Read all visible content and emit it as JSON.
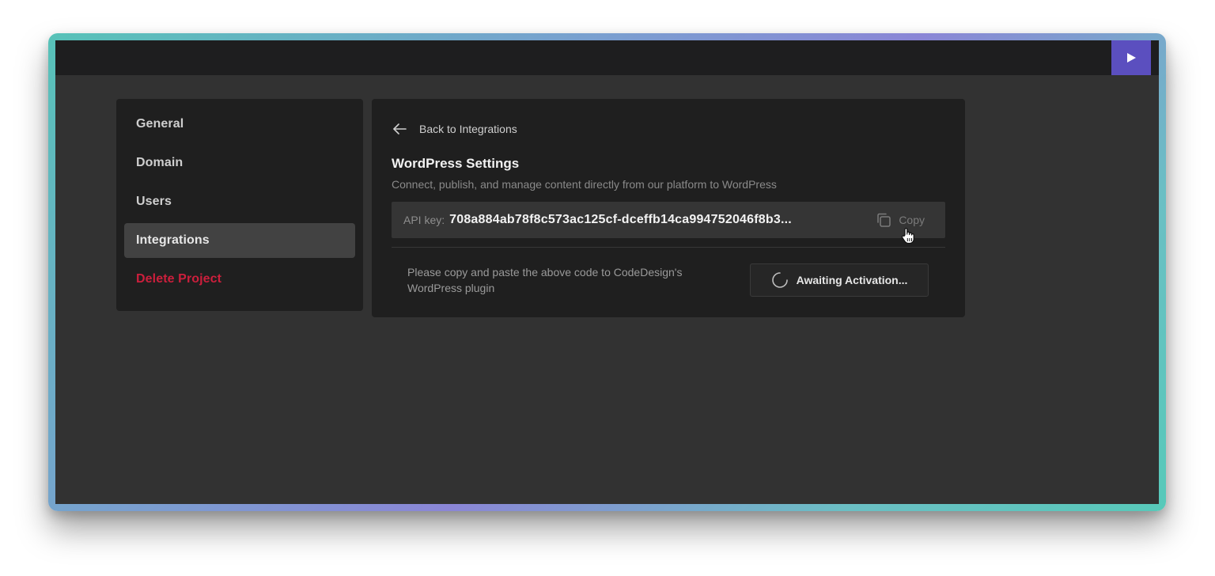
{
  "header": {
    "play_icon": "play-icon",
    "accent_color": "#5b4fbf"
  },
  "sidebar": {
    "items": [
      {
        "label": "General"
      },
      {
        "label": "Domain"
      },
      {
        "label": "Users"
      },
      {
        "label": "Integrations",
        "active": true
      },
      {
        "label": "Delete Project",
        "danger": true
      }
    ],
    "danger_color": "#cc1f3c"
  },
  "panel": {
    "back_label": "Back to Integrations",
    "back_icon": "arrow-left-icon",
    "title": "WordPress Settings",
    "subtitle": "Connect, publish, and manage content directly from our platform to WordPress",
    "api_key_label": "API key:",
    "api_key_value": "708a884ab78f8c573ac125cf-dceffb14ca994752046f8b3...",
    "copy_label": "Copy",
    "copy_icon": "copy-icon",
    "instruction": "Please copy and paste the above code to CodeDesign's WordPress plugin",
    "await_label": "Awaiting Activation...",
    "await_icon": "spinner-icon"
  }
}
